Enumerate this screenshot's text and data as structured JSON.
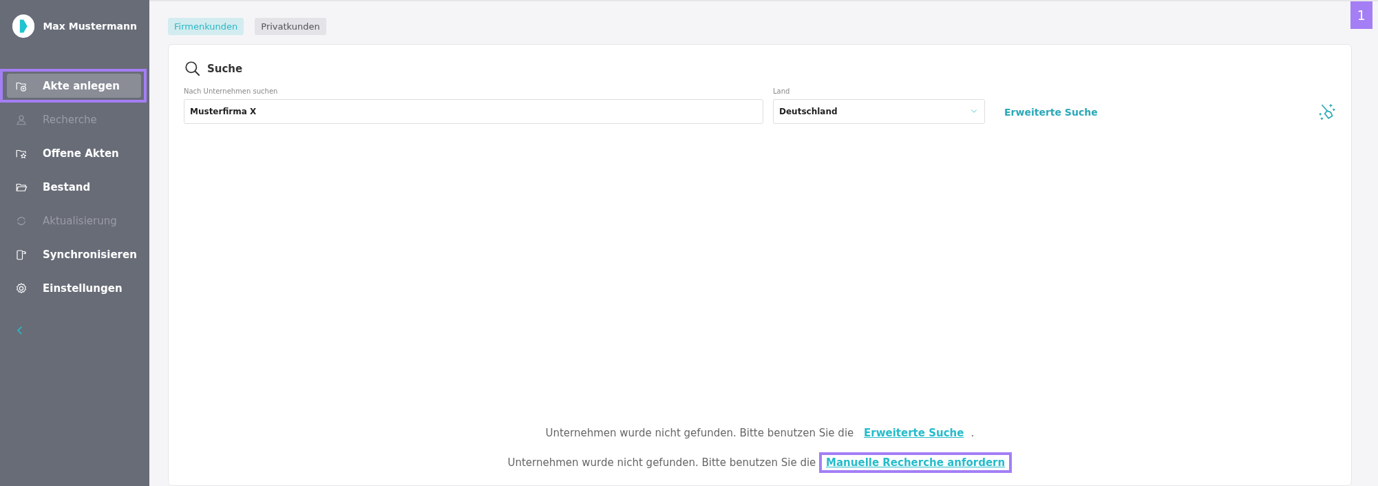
{
  "user": {
    "name": "Max Mustermann"
  },
  "sidebar": {
    "items": [
      {
        "label": "Akte anlegen",
        "selected": true,
        "disabled": false,
        "highlighted": true
      },
      {
        "label": "Recherche",
        "selected": false,
        "disabled": true,
        "highlighted": false
      },
      {
        "label": "Offene Akten",
        "selected": false,
        "disabled": false,
        "highlighted": false
      },
      {
        "label": "Bestand",
        "selected": false,
        "disabled": false,
        "highlighted": false
      },
      {
        "label": "Aktualisierung",
        "selected": false,
        "disabled": true,
        "highlighted": false
      },
      {
        "label": "Synchronisieren",
        "selected": false,
        "disabled": false,
        "highlighted": false
      },
      {
        "label": "Einstellungen",
        "selected": false,
        "disabled": false,
        "highlighted": false
      }
    ]
  },
  "step_badge": "1",
  "tabs": [
    {
      "label": "Firmenkunden",
      "selected": true
    },
    {
      "label": "Privatkunden",
      "selected": false
    }
  ],
  "search": {
    "title": "Suche",
    "company_field": {
      "label": "Nach Unternehmen suchen",
      "value": "Musterfirma X"
    },
    "country_field": {
      "label": "Land",
      "value": "Deutschland"
    },
    "advanced_link": "Erweiterte Suche"
  },
  "messages": [
    {
      "text": "Unternehmen wurde nicht gefunden. Bitte benutzen Sie die ",
      "link": "Erweiterte Suche",
      "after": ".",
      "highlighted": false
    },
    {
      "text": "Unternehmen wurde nicht gefunden. Bitte benutzen Sie die ",
      "link": "Manuelle Recherche anfordern",
      "highlighted": true
    }
  ]
}
